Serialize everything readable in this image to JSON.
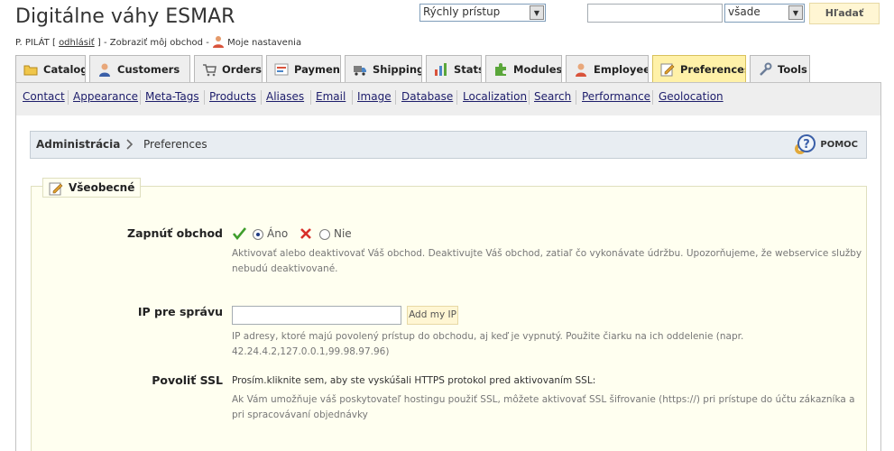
{
  "header": {
    "shop_title": "Digitálne váhy ESMAR",
    "user_name": "P. PILÁT [",
    "logout_label": "odhlásiť",
    "user_mid": "] - Zobraziť môj obchod -",
    "my_settings_label": "Moje nastavenia",
    "quick_access": "Rýchly prístup",
    "search_value": "",
    "search_scope": "všade",
    "search_button": "Hľadať"
  },
  "tabs": [
    "Catalog",
    "Customers",
    "Orders",
    "Payment",
    "Shipping",
    "Stats",
    "Modules",
    "Employees",
    "Preferences",
    "Tools"
  ],
  "active_tab": "Preferences",
  "subnav": [
    "Contact",
    "Appearance",
    "Meta-Tags",
    "Products",
    "Aliases",
    "Email",
    "Image",
    "Database",
    "Localization",
    "Search",
    "Performance",
    "Geolocation"
  ],
  "breadcrumb": {
    "root": "Administrácia",
    "current": "Preferences",
    "help_label": "POMOC"
  },
  "section": {
    "legend": "Všeobecné",
    "enable_shop": {
      "label": "Zapnúť obchod",
      "yes": "Áno",
      "no": "Nie",
      "selected": "Áno",
      "hint": "Aktivovať alebo deaktivovať Váš obchod. Deaktivujte Váš obchod, zatiaľ čo vykonávate údržbu. Upozorňujeme, že webservice služby nebudú deaktivované."
    },
    "maintenance_ip": {
      "label": "IP pre správu",
      "value": "",
      "add_button": "Add my IP",
      "hint": "IP adresy, ktoré majú povolený prístup do obchodu, aj keď je vypnutý. Použite čiarku na ich oddelenie (napr. 42.24.4.2,127.0.0.1,99.98.97.96)"
    },
    "ssl": {
      "label": "Povoliť SSL",
      "link_text": "Prosím.kliknite sem, aby ste vyskúšali HTTPS protokol pred aktivovaním SSL:",
      "hint": "Ak Vám umožňuje váš poskytovateľ hostingu použiť SSL, môžete aktivovať SSL šifrovanie (https://) pri prístupe do účtu zákazníka a pri spracovávaní objednávky"
    }
  },
  "icons": [
    "catalog-icon",
    "customers-icon",
    "orders-icon",
    "payment-icon",
    "shipping-icon",
    "stats-icon",
    "modules-icon",
    "employees-icon",
    "preferences-icon",
    "tools-icon",
    "help-icon",
    "check-icon",
    "cross-icon",
    "legend-icon",
    "user-icon"
  ]
}
